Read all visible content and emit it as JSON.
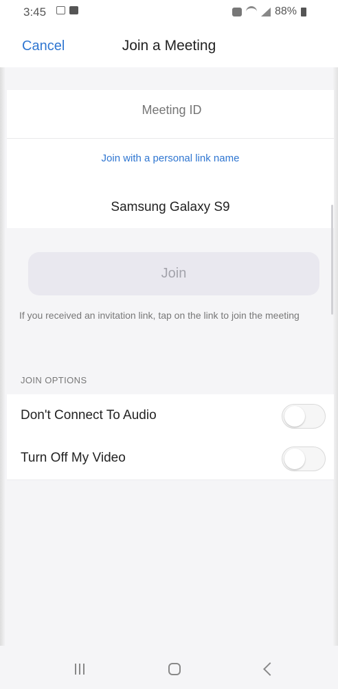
{
  "status_bar": {
    "time": "3:45",
    "battery": "88%"
  },
  "header": {
    "cancel_label": "Cancel",
    "title": "Join a Meeting"
  },
  "meeting": {
    "id_placeholder": "Meeting ID",
    "personal_link_label": "Join with a personal link name",
    "name_value": "Samsung Galaxy S9"
  },
  "join": {
    "button_label": "Join",
    "invitation_hint": "If you received an invitation link, tap on the link to join the meeting"
  },
  "join_options": {
    "section_label": "JOIN OPTIONS",
    "options": [
      {
        "label": "Don't Connect To Audio",
        "enabled": false
      },
      {
        "label": "Turn Off My Video",
        "enabled": false
      }
    ]
  },
  "nav_bar": {
    "icons": [
      "recents-icon",
      "home-icon",
      "back-icon"
    ]
  },
  "colors": {
    "accent": "#2f76d1",
    "background": "#f5f5f7",
    "join_button": "#e9e8ef"
  }
}
